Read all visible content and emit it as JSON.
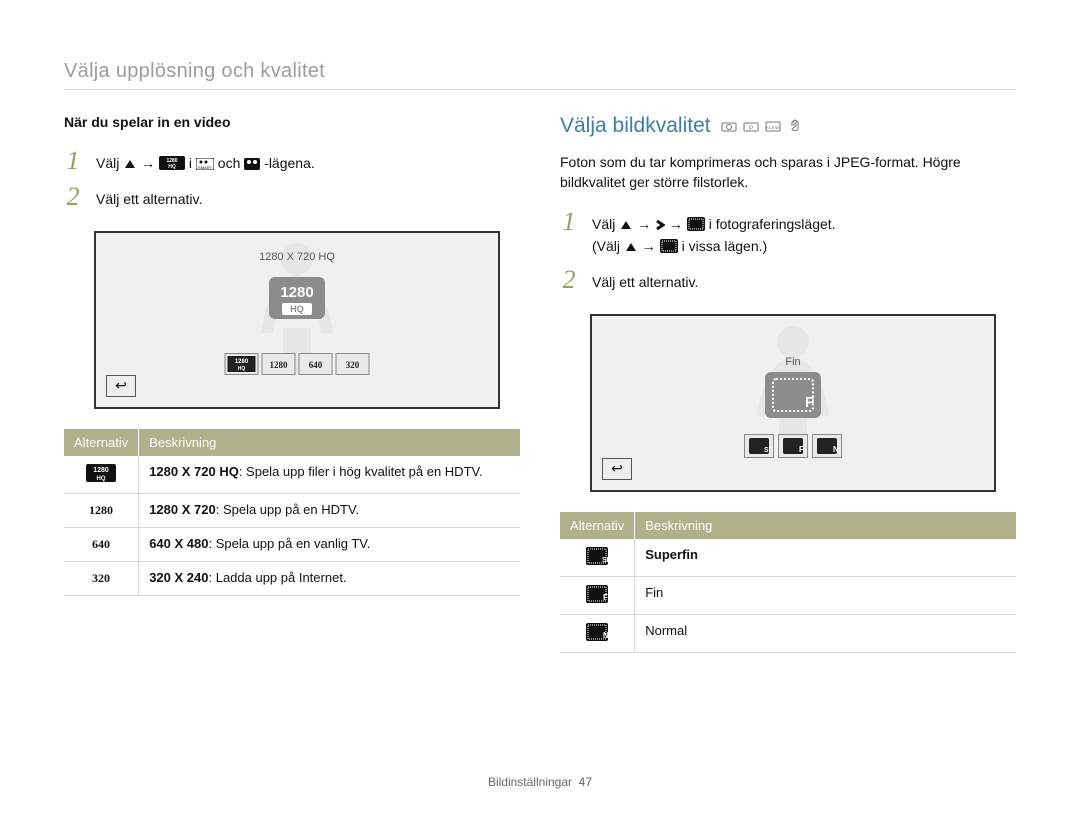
{
  "breadcrumb": "Välja upplösning och kvalitet",
  "left": {
    "subhead": "När du spelar in en video",
    "step1_a": "Välj ",
    "step1_b": " → ",
    "step1_c": " i ",
    "step1_d": " och ",
    "step1_e": " -lägena.",
    "step2": "Välj ett alternativ.",
    "screen_label": "1280 X 720 HQ",
    "opts": [
      "1280HQ",
      "1280",
      "640",
      "320"
    ],
    "table": {
      "h1": "Alternativ",
      "h2": "Beskrivning",
      "rows": [
        {
          "icon": "1280HQ",
          "lead": "1280 X 720 HQ",
          "text": ": Spela upp filer i hög kvalitet på en HDTV."
        },
        {
          "icon": "1280",
          "lead": "1280 X 720",
          "text": ": Spela upp på en HDTV."
        },
        {
          "icon": "640",
          "lead": "640 X 480",
          "text": ": Spela upp på en vanlig TV."
        },
        {
          "icon": "320",
          "lead": "320 X 240",
          "text": ": Ladda upp på Internet."
        }
      ]
    }
  },
  "right": {
    "title": "Välja bildkvalitet",
    "para": "Foton som du tar komprimeras och sparas i JPEG-format. Högre bildkvalitet ger större filstorlek.",
    "step1_a": "Välj ",
    "step1_b": " → ",
    "step1_c": " → ",
    "step1_d": " i fotograferingsläget.",
    "step1_paren_a": "(Välj ",
    "step1_paren_b": " → ",
    "step1_paren_c": " i vissa lägen.)",
    "step2": "Välj ett alternativ.",
    "screen_label": "Fin",
    "table": {
      "h1": "Alternativ",
      "h2": "Beskrivning",
      "rows": [
        {
          "icon": "SF",
          "label": "Superfin"
        },
        {
          "icon": "F",
          "label": "Fin"
        },
        {
          "icon": "N",
          "label": "Normal"
        }
      ]
    }
  },
  "footer": {
    "section": "Bildinställningar",
    "page": "47"
  }
}
